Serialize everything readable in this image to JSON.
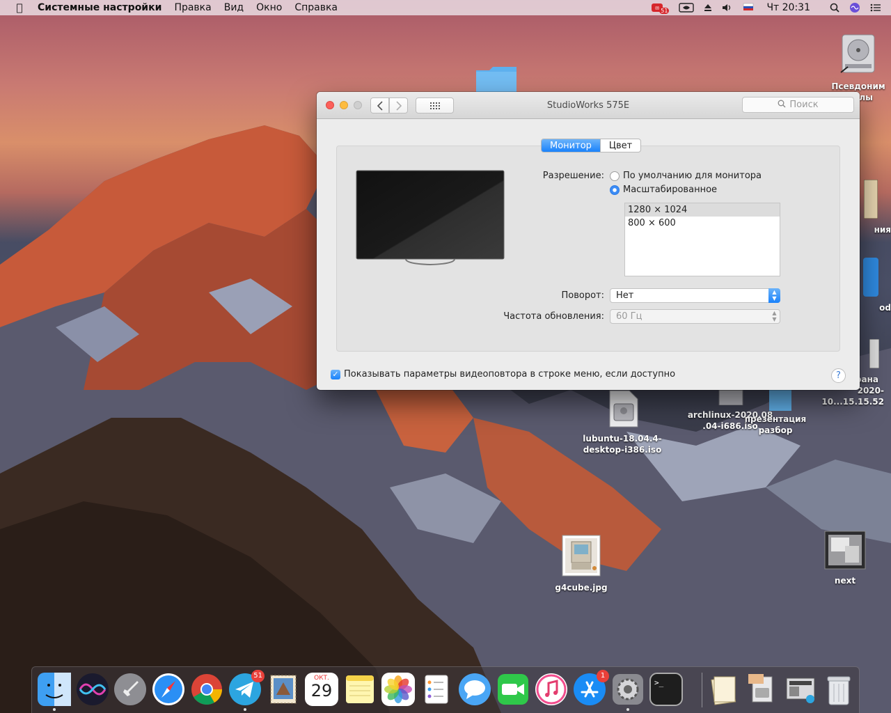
{
  "menubar": {
    "apple_icon": "apple-logo-icon",
    "app_name": "Системные настройки",
    "items": [
      "Правка",
      "Вид",
      "Окно",
      "Справка"
    ],
    "tray": {
      "notification_badge": "51",
      "language_label": "PC",
      "clock": "Чт 20:31"
    }
  },
  "window": {
    "title": "StudioWorks 575E",
    "search_placeholder": "Поиск",
    "tabs": [
      {
        "label": "Монитор",
        "active": true
      },
      {
        "label": "Цвет",
        "active": false
      }
    ],
    "resolution": {
      "label": "Разрешение:",
      "options": [
        {
          "label": "По умолчанию для монитора",
          "selected": false
        },
        {
          "label": "Масштабированное",
          "selected": true
        }
      ],
      "list": [
        "1280 × 1024",
        "800 × 600"
      ],
      "list_selected_index": 0
    },
    "rotation": {
      "label": "Поворот:",
      "value": "Нет"
    },
    "refresh": {
      "label": "Частота обновления:",
      "value": "60 Гц"
    },
    "mirroring_checkbox": {
      "label": "Показывать параметры видеоповтора в строке меню, если доступно",
      "checked": true
    },
    "help_label": "?"
  },
  "desktop": {
    "icons": [
      {
        "label": "Псевдоним",
        "label2": "лы",
        "icon": "hard-drive-icon"
      },
      {
        "label": "lubuntu-18.04.4-",
        "label2": "desktop-i386.iso",
        "icon": "disk-image-icon"
      },
      {
        "label": "archlinux-2020.08",
        "label2": ".04-i686.iso",
        "icon": "disk-image-icon"
      },
      {
        "label": "презентация",
        "label2": "разбор",
        "icon": "folder-icon"
      },
      {
        "label": "рана",
        "label2": "2020-10...15.15.52",
        "icon": "screenshot-icon"
      },
      {
        "label": "ния",
        "label2": "",
        "icon": "document-icon"
      },
      {
        "label": "od",
        "label2": "",
        "icon": "app-icon"
      },
      {
        "label": "g4cube.jpg",
        "label2": "",
        "icon": "image-file-icon"
      },
      {
        "label": "next",
        "label2": "",
        "icon": "image-file-icon"
      }
    ]
  },
  "dock": {
    "calendar_month": "ОКТ.",
    "calendar_day": "29",
    "telegram_badge": "51",
    "appstore_badge": "1",
    "terminal_prompt": ">_",
    "apps": [
      "finder",
      "siri",
      "launchpad",
      "safari",
      "chrome",
      "telegram",
      "mail",
      "calendar",
      "notes",
      "photos",
      "reminders",
      "messages",
      "facetime",
      "itunes",
      "appstore",
      "system-preferences",
      "terminal",
      "documents-stack",
      "trash"
    ]
  }
}
